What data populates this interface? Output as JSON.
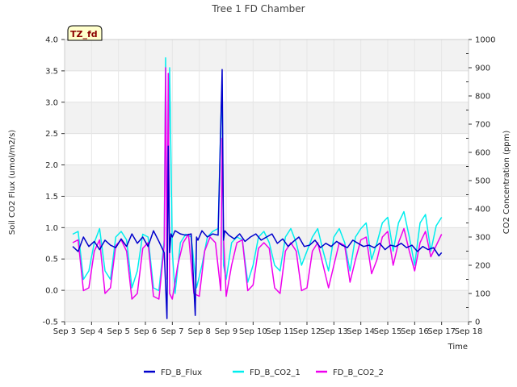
{
  "chart_data": {
    "type": "line",
    "title": "Tree 1 FD Chamber",
    "xlabel": "Time",
    "ylabel_left": "Soil CO2 Flux (umol/m2/s)",
    "ylabel_right": "CO2 Concentration (ppm)",
    "tag": "TZ_fd",
    "x_range": [
      3,
      18
    ],
    "y_left_range": [
      -0.5,
      4.0
    ],
    "y_right_range": [
      0,
      1000
    ],
    "x_ticks": [
      {
        "v": 3,
        "label": "Sep 3"
      },
      {
        "v": 4,
        "label": "Sep 4"
      },
      {
        "v": 5,
        "label": "Sep 5"
      },
      {
        "v": 6,
        "label": "Sep 6"
      },
      {
        "v": 7,
        "label": "Sep 7"
      },
      {
        "v": 8,
        "label": "Sep 8"
      },
      {
        "v": 9,
        "label": "Sep 9"
      },
      {
        "v": 10,
        "label": "Sep 10"
      },
      {
        "v": 11,
        "label": "Sep 11"
      },
      {
        "v": 12,
        "label": "Sep 12"
      },
      {
        "v": 13,
        "label": "Sep 13"
      },
      {
        "v": 14,
        "label": "Sep 14"
      },
      {
        "v": 15,
        "label": "Sep 15"
      },
      {
        "v": 16,
        "label": "Sep 16"
      },
      {
        "v": 17,
        "label": "Sep 17"
      },
      {
        "v": 18,
        "label": "Sep 18"
      }
    ],
    "y_left_ticks": [
      {
        "v": -0.5,
        "label": "-0.5"
      },
      {
        "v": 0.0,
        "label": "0.0"
      },
      {
        "v": 0.5,
        "label": "0.5"
      },
      {
        "v": 1.0,
        "label": "1.0"
      },
      {
        "v": 1.5,
        "label": "1.5"
      },
      {
        "v": 2.0,
        "label": "2.0"
      },
      {
        "v": 2.5,
        "label": "2.5"
      },
      {
        "v": 3.0,
        "label": "3.0"
      },
      {
        "v": 3.5,
        "label": "3.5"
      },
      {
        "v": 4.0,
        "label": "4.0"
      }
    ],
    "y_right_ticks": [
      {
        "v": 0,
        "label": "0"
      },
      {
        "v": 100,
        "label": "100"
      },
      {
        "v": 200,
        "label": "200"
      },
      {
        "v": 300,
        "label": "300"
      },
      {
        "v": 400,
        "label": "400"
      },
      {
        "v": 500,
        "label": "500"
      },
      {
        "v": 600,
        "label": "600"
      },
      {
        "v": 700,
        "label": "700"
      },
      {
        "v": 800,
        "label": "800"
      },
      {
        "v": 900,
        "label": "900"
      },
      {
        "v": 1000,
        "label": "1000"
      }
    ],
    "bands_left": [
      [
        -0.5,
        0.0
      ],
      [
        0.5,
        1.0
      ],
      [
        1.5,
        2.0
      ],
      [
        2.5,
        3.0
      ],
      [
        3.5,
        4.0
      ]
    ],
    "grid": true,
    "legend_position": "bottom-center",
    "series": [
      {
        "name": "FD_B_Flux",
        "color": "#0000cc",
        "axis": "left",
        "x": [
          3.3,
          3.5,
          3.7,
          3.9,
          4.1,
          4.3,
          4.5,
          4.7,
          4.9,
          5.1,
          5.3,
          5.5,
          5.7,
          5.9,
          6.1,
          6.3,
          6.5,
          6.7,
          6.8,
          6.85,
          6.9,
          6.95,
          7.0,
          7.1,
          7.3,
          7.5,
          7.7,
          7.85,
          7.9,
          7.95,
          8.1,
          8.3,
          8.5,
          8.7,
          8.85,
          8.9,
          8.95,
          9.1,
          9.3,
          9.5,
          9.7,
          9.9,
          10.1,
          10.3,
          10.5,
          10.7,
          10.9,
          11.1,
          11.3,
          11.5,
          11.7,
          11.9,
          12.1,
          12.3,
          12.5,
          12.7,
          12.9,
          13.1,
          13.3,
          13.5,
          13.7,
          13.9,
          14.1,
          14.3,
          14.5,
          14.7,
          14.9,
          15.1,
          15.3,
          15.5,
          15.7,
          15.9,
          16.1,
          16.3,
          16.5,
          16.7,
          16.9,
          17.0
        ],
        "y": [
          0.7,
          0.62,
          0.85,
          0.7,
          0.78,
          0.65,
          0.8,
          0.72,
          0.68,
          0.82,
          0.7,
          0.9,
          0.75,
          0.85,
          0.7,
          0.95,
          0.78,
          0.6,
          -0.45,
          2.3,
          0.6,
          0.9,
          0.85,
          0.95,
          0.9,
          0.88,
          0.9,
          -0.4,
          0.85,
          0.8,
          0.95,
          0.85,
          0.9,
          0.88,
          3.52,
          0.8,
          0.95,
          0.88,
          0.82,
          0.9,
          0.78,
          0.85,
          0.9,
          0.8,
          0.85,
          0.9,
          0.75,
          0.82,
          0.7,
          0.78,
          0.85,
          0.7,
          0.72,
          0.8,
          0.68,
          0.75,
          0.7,
          0.78,
          0.72,
          0.68,
          0.8,
          0.75,
          0.7,
          0.72,
          0.68,
          0.75,
          0.65,
          0.72,
          0.7,
          0.75,
          0.68,
          0.72,
          0.62,
          0.7,
          0.65,
          0.68,
          0.55,
          0.6
        ]
      },
      {
        "name": "FD_B_CO2_1",
        "color": "#00eeee",
        "axis": "right",
        "x": [
          3.3,
          3.5,
          3.7,
          3.9,
          4.1,
          4.3,
          4.5,
          4.7,
          4.9,
          5.1,
          5.3,
          5.5,
          5.7,
          5.9,
          6.1,
          6.3,
          6.5,
          6.7,
          6.75,
          6.8,
          6.9,
          7.0,
          7.1,
          7.3,
          7.5,
          7.7,
          7.9,
          8.1,
          8.3,
          8.5,
          8.7,
          8.8,
          8.85,
          8.9,
          9.0,
          9.2,
          9.4,
          9.6,
          9.8,
          10.0,
          10.2,
          10.4,
          10.6,
          10.8,
          11.0,
          11.2,
          11.4,
          11.6,
          11.8,
          12.0,
          12.2,
          12.4,
          12.6,
          12.8,
          13.0,
          13.2,
          13.4,
          13.6,
          13.8,
          14.0,
          14.2,
          14.4,
          14.6,
          14.8,
          15.0,
          15.2,
          15.4,
          15.6,
          15.8,
          16.0,
          16.2,
          16.4,
          16.6,
          16.8,
          17.0
        ],
        "y": [
          310,
          320,
          150,
          180,
          280,
          330,
          180,
          150,
          300,
          320,
          290,
          120,
          180,
          310,
          300,
          120,
          110,
          290,
          935,
          200,
          900,
          250,
          100,
          280,
          310,
          300,
          120,
          200,
          300,
          320,
          330,
          700,
          840,
          200,
          150,
          280,
          300,
          290,
          140,
          200,
          300,
          320,
          280,
          200,
          180,
          300,
          330,
          280,
          200,
          250,
          300,
          330,
          250,
          180,
          300,
          330,
          280,
          180,
          300,
          330,
          350,
          220,
          280,
          350,
          370,
          250,
          350,
          390,
          300,
          200,
          350,
          380,
          250,
          340,
          370
        ]
      },
      {
        "name": "FD_B_CO2_2",
        "color": "#ee00ee",
        "axis": "right",
        "x": [
          3.3,
          3.5,
          3.7,
          3.9,
          4.1,
          4.3,
          4.5,
          4.7,
          4.9,
          5.1,
          5.3,
          5.5,
          5.7,
          5.9,
          6.1,
          6.3,
          6.5,
          6.7,
          6.75,
          6.8,
          6.85,
          6.9,
          7.0,
          7.2,
          7.4,
          7.6,
          7.8,
          8.0,
          8.2,
          8.4,
          8.6,
          8.8,
          8.85,
          8.9,
          9.0,
          9.2,
          9.4,
          9.6,
          9.8,
          10.0,
          10.2,
          10.4,
          10.6,
          10.8,
          11.0,
          11.2,
          11.4,
          11.6,
          11.8,
          12.0,
          12.2,
          12.4,
          12.6,
          12.8,
          13.0,
          13.2,
          13.4,
          13.6,
          13.8,
          14.0,
          14.2,
          14.4,
          14.6,
          14.8,
          15.0,
          15.2,
          15.4,
          15.6,
          15.8,
          16.0,
          16.2,
          16.4,
          16.6,
          16.8,
          17.0
        ],
        "y": [
          280,
          290,
          110,
          120,
          250,
          290,
          100,
          120,
          270,
          290,
          250,
          80,
          100,
          260,
          280,
          90,
          80,
          270,
          900,
          150,
          880,
          100,
          80,
          200,
          280,
          310,
          100,
          90,
          250,
          300,
          280,
          110,
          650,
          300,
          90,
          200,
          280,
          290,
          110,
          130,
          260,
          280,
          260,
          120,
          100,
          250,
          280,
          250,
          110,
          120,
          250,
          280,
          200,
          120,
          200,
          280,
          270,
          140,
          220,
          290,
          300,
          170,
          220,
          300,
          320,
          200,
          280,
          330,
          250,
          180,
          280,
          320,
          230,
          270,
          310
        ]
      }
    ]
  }
}
